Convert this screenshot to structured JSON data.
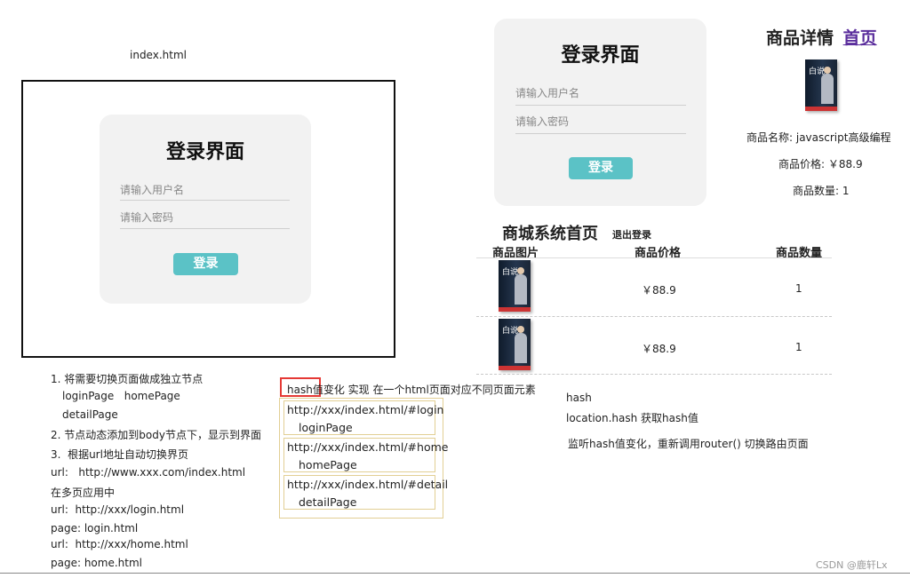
{
  "index_label": "index.html",
  "login_ui": {
    "title": "登录界面",
    "username_placeholder": "请输入用户名",
    "password_placeholder": "请输入密码",
    "button": "登录"
  },
  "detail": {
    "title": "商品详情",
    "home_link": "首页",
    "name": "商品名称: javascript高级编程",
    "price": "商品价格: ￥88.9",
    "qty": "商品数量: 1",
    "book_title": "白说"
  },
  "home": {
    "title": "商城系统首页",
    "logout": "退出登录",
    "headers": [
      "商品图片",
      "商品价格",
      "商品数量"
    ],
    "rows": [
      {
        "price": "￥88.9",
        "qty": "1"
      },
      {
        "price": "￥88.9",
        "qty": "1"
      }
    ]
  },
  "notes_left": [
    "1. 将需要切换页面做成独立节点",
    "loginPage   homePage",
    "detailPage",
    "2. 节点动态添加到body节点下，显示到界面",
    "3.  根据url地址自动切换界页",
    "url:   http://www.xxx.com/index.html",
    "在多页应用中",
    "url:  http://xxx/login.html",
    "page: login.html",
    "url:  http://xxx/home.html",
    "page: home.html"
  ],
  "hash_header": {
    "highlight": "hash值",
    "rest": "变化 实现 在一个html页面对应不同页面元素"
  },
  "hash_routes": [
    {
      "url": "http://xxx/index.html/#login",
      "page": "loginPage"
    },
    {
      "url": "http://xxx/index.html/#home",
      "page": "homePage"
    },
    {
      "url": "http://xxx/index.html/#detail",
      "page": "detailPage"
    }
  ],
  "notes_right": [
    "hash",
    "location.hash 获取hash值",
    "监听hash值变化，重新调用router() 切换路由页面"
  ],
  "watermark": "CSDN @鹿轩Lx",
  "colors": {
    "button": "#5bc2c6",
    "link": "#5a2d9c",
    "highlight_border": "#e53935",
    "route_border": "#e2cf94"
  }
}
